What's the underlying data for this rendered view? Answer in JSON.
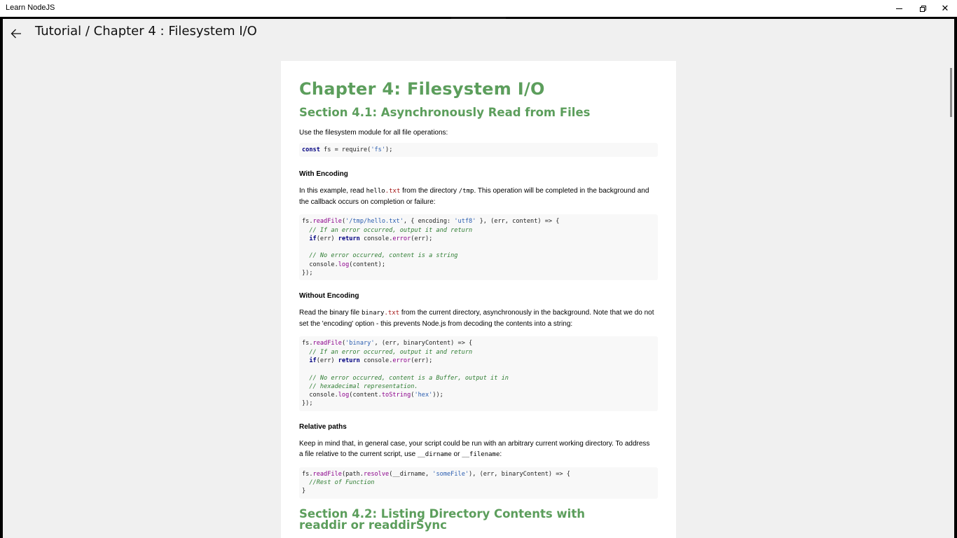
{
  "window": {
    "title": "Learn NodeJS"
  },
  "header": {
    "title": "Tutorial / Chapter 4 :  Filesystem I/O"
  },
  "colors": {
    "heading": "#5c9e5c",
    "keyword": "#000080",
    "function": "#8b008b",
    "string": "#2a5db0",
    "comment": "#2e7d32"
  },
  "content": {
    "chapter_title": "Chapter 4: Filesystem I/O",
    "section1": {
      "title": "Section 4.1: Asynchronously Read from Files",
      "intro": "Use the filesystem module for all file operations:",
      "code_require": {
        "kw": "const",
        "rest1": " fs = require(",
        "str": "'fs'",
        "rest2": ");"
      },
      "with_encoding": {
        "heading": "With Encoding",
        "p1_a": "In this example, read ",
        "p1_code_a": "hello",
        "p1_code_b": ".txt",
        "p1_b": " from the directory ",
        "p1_code_c": "/tmp",
        "p1_c": ". This operation will be completed in the background and",
        "p1_line2": "the callback occurs on completion or failure:",
        "code": {
          "l1_a": "fs.",
          "l1_fn": "readFile",
          "l1_b": "(",
          "l1_str1": "'/tmp/hello.txt'",
          "l1_c": ", { encoding: ",
          "l1_str2": "'utf8'",
          "l1_d": " }, (err, content) => {",
          "l2": "  // If an error occurred, output it and return",
          "l3_a": "  ",
          "l3_kw1": "if",
          "l3_b": "(err) ",
          "l3_kw2": "return",
          "l3_c": " console.",
          "l3_fn": "error",
          "l3_d": "(err);",
          "l5": "  // No error occurred, content is a string",
          "l6_a": "  console.",
          "l6_fn": "log",
          "l6_b": "(content);",
          "l7": "});"
        }
      },
      "without_encoding": {
        "heading": "Without Encoding",
        "p_a": "Read the binary file ",
        "p_code_a": "binary",
        "p_code_b": ".txt",
        "p_b": " from the current directory, asynchronously in the background. Note that we do not",
        "p_line2": "set the 'encoding' option - this prevents Node.js from decoding the contents into a string:",
        "code": {
          "l1_a": "fs.",
          "l1_fn": "readFile",
          "l1_b": "(",
          "l1_str": "'binary'",
          "l1_c": ", (err, binaryContent) => {",
          "l2": "  // If an error occurred, output it and return",
          "l3_a": "  ",
          "l3_kw1": "if",
          "l3_b": "(err) ",
          "l3_kw2": "return",
          "l3_c": " console.",
          "l3_fn": "error",
          "l3_d": "(err);",
          "l5": "  // No error occurred, content is a Buffer, output it in",
          "l6": "  // hexadecimal representation.",
          "l7_a": "  console.",
          "l7_fn1": "log",
          "l7_b": "(content.",
          "l7_fn2": "toString",
          "l7_c": "(",
          "l7_str": "'hex'",
          "l7_d": "));",
          "l8": "});"
        }
      },
      "relative_paths": {
        "heading": "Relative paths",
        "p_line1": "Keep in mind that, in general case, your script could be run with an arbitrary current working directory. To address",
        "p_a": "a file relative to the current script, use ",
        "p_code_a": "__dirname",
        "p_b": " or ",
        "p_code_b": "__filename",
        "p_c": ":",
        "code": {
          "l1_a": "fs.",
          "l1_fn1": "readFile",
          "l1_b": "(path.",
          "l1_fn2": "resolve",
          "l1_c": "(__dirname, ",
          "l1_str": "'someFile'",
          "l1_d": "), (err, binaryContent) => {",
          "l2": "  //Rest of Function",
          "l3": "}"
        }
      }
    },
    "section2": {
      "title": "Section 4.2: Listing Directory Contents with readdir or readdirSync"
    }
  }
}
